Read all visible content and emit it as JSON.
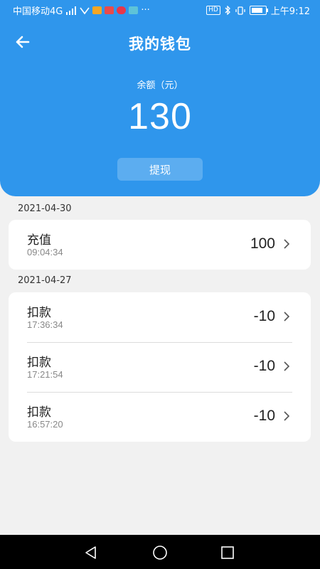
{
  "status_bar": {
    "carrier": "中国移动4G",
    "time": "上午9:12",
    "dots": "···",
    "hd": "HD"
  },
  "header": {
    "title": "我的钱包",
    "balance_label": "余额（元）",
    "balance_value": "130",
    "withdraw_label": "提现"
  },
  "groups": [
    {
      "date": "2021-04-30",
      "items": [
        {
          "name": "充值",
          "time": "09:04:34",
          "amount": "100"
        }
      ]
    },
    {
      "date": "2021-04-27",
      "items": [
        {
          "name": "扣款",
          "time": "17:36:34",
          "amount": "-10"
        },
        {
          "name": "扣款",
          "time": "17:21:54",
          "amount": "-10"
        },
        {
          "name": "扣款",
          "time": "16:57:20",
          "amount": "-10"
        }
      ]
    }
  ],
  "icons": {
    "back": "arrow-left-icon",
    "chevron": "chevron-right-icon",
    "nav": [
      "back-triangle-icon",
      "home-circle-icon",
      "recents-square-icon"
    ]
  },
  "colors": {
    "primary": "#2f96ec",
    "background": "#f1f1f1",
    "card": "#ffffff"
  }
}
